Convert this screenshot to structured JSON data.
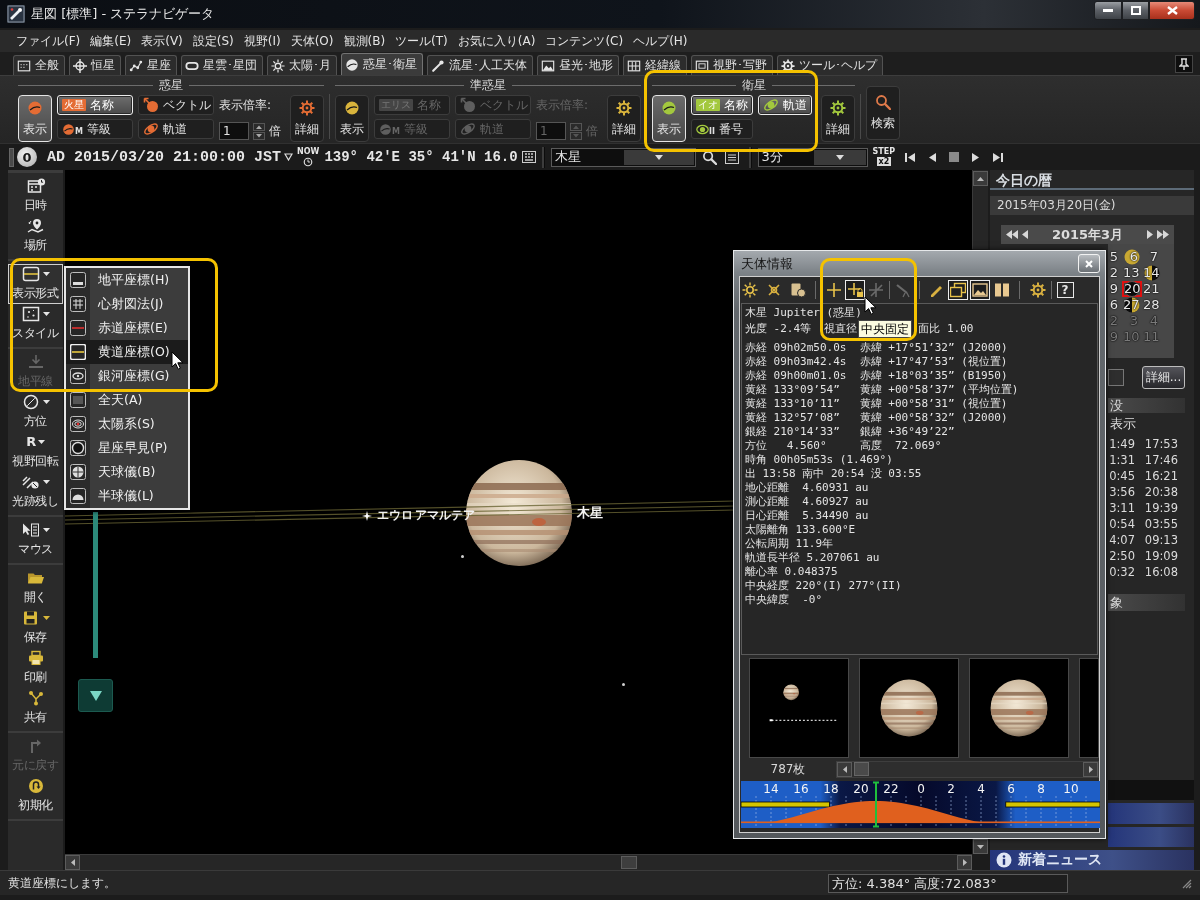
{
  "window": {
    "title": "星図 [標準] - ステラナビゲータ"
  },
  "menu": [
    "ファイル(F)",
    "編集(E)",
    "表示(V)",
    "設定(S)",
    "視野(I)",
    "天体(O)",
    "観測(B)",
    "ツール(T)",
    "お気に入り(A)",
    "コンテンツ(C)",
    "ヘルプ(H)"
  ],
  "tabs": [
    {
      "label": "全般",
      "selected": false
    },
    {
      "label": "恒星",
      "selected": false
    },
    {
      "label": "星座",
      "selected": false
    },
    {
      "label": "星雲･星団",
      "selected": false
    },
    {
      "label": "太陽･月",
      "selected": false
    },
    {
      "label": "惑星･衛星",
      "selected": true
    },
    {
      "label": "流星･人工天体",
      "selected": false
    },
    {
      "label": "昼光･地形",
      "selected": false
    },
    {
      "label": "経緯線",
      "selected": false
    },
    {
      "label": "視野･写野",
      "selected": false
    },
    {
      "label": "ツール･ヘルプ",
      "selected": false
    }
  ],
  "ribbon": {
    "groups": [
      {
        "title": "惑星",
        "highlighted": false,
        "show": {
          "label": "表示",
          "on": true
        },
        "toggles": [
          {
            "kind": "name",
            "label": "名称",
            "tag": "火星",
            "on": true,
            "disabled": false
          },
          {
            "kind": "vector",
            "label": "ベクトル",
            "on": false,
            "disabled": false
          },
          {
            "kind": "magnitude",
            "label": "等級",
            "tag": "M",
            "on": false,
            "disabled": false
          },
          {
            "kind": "orbit",
            "label": "軌道",
            "on": false,
            "disabled": false
          }
        ],
        "scale": {
          "label": "表示倍率:",
          "value": "1",
          "unit": "倍",
          "disabled": false
        },
        "detail": "詳細"
      },
      {
        "title": "準惑星",
        "highlighted": false,
        "show": {
          "label": "表示",
          "on": false
        },
        "toggles": [
          {
            "kind": "name",
            "label": "名称",
            "tag": "エリス",
            "on": false,
            "disabled": true
          },
          {
            "kind": "vector",
            "label": "ベクトル",
            "on": false,
            "disabled": true
          },
          {
            "kind": "magnitude",
            "label": "等級",
            "tag": "M",
            "on": false,
            "disabled": true
          },
          {
            "kind": "orbit",
            "label": "軌道",
            "on": false,
            "disabled": true
          }
        ],
        "scale": {
          "label": "表示倍率:",
          "value": "1",
          "unit": "倍",
          "disabled": true
        },
        "detail": "詳細"
      },
      {
        "title": "衛星",
        "highlighted": true,
        "show": {
          "label": "表示",
          "on": true
        },
        "toggles": [
          {
            "kind": "name",
            "label": "名称",
            "tag": "イオ",
            "on": true,
            "disabled": false
          },
          {
            "kind": "orbit",
            "label": "軌道",
            "on": true,
            "disabled": false
          },
          {
            "kind": "number",
            "label": "番号",
            "tag": "II",
            "on": false,
            "disabled": false
          }
        ],
        "detail": "詳細"
      }
    ],
    "search": "検索"
  },
  "time_bar": {
    "moon_age": "0",
    "datetime": "AD 2015/03/20 21:00:00 JST",
    "now_label": "NOW",
    "location": "139° 42'E 35° 41'N 16.0",
    "target": "木星",
    "step": "3分",
    "step_label": "STEP",
    "step_factor": "x2"
  },
  "sidebar": {
    "groups": [
      {
        "items": [
          {
            "kind": "datetime",
            "label": "日時",
            "menu": false,
            "open": false,
            "disabled": false
          },
          {
            "kind": "place",
            "label": "場所",
            "menu": false,
            "open": false,
            "disabled": false
          }
        ]
      },
      {
        "items": [
          {
            "kind": "view",
            "label": "表示形式",
            "menu": true,
            "open": true,
            "disabled": false
          },
          {
            "kind": "style",
            "label": "スタイル",
            "menu": true,
            "open": false,
            "disabled": false
          }
        ]
      },
      {
        "items": [
          {
            "kind": "horizon",
            "label": "地平線",
            "menu": false,
            "open": false,
            "disabled": true
          },
          {
            "kind": "direction",
            "label": "方位",
            "menu": true,
            "open": false,
            "disabled": false
          },
          {
            "kind": "rotate",
            "label": "視野回転",
            "glyph": "R",
            "menu": true,
            "open": false,
            "disabled": false
          },
          {
            "kind": "trail",
            "label": "光跡残し",
            "menu": true,
            "open": false,
            "disabled": false
          }
        ]
      },
      {
        "items": [
          {
            "kind": "mouse",
            "label": "マウス",
            "menu": true,
            "open": false,
            "disabled": false
          }
        ]
      },
      {
        "items": [
          {
            "kind": "open",
            "label": "開く",
            "menu": false,
            "open": false,
            "disabled": false
          },
          {
            "kind": "save",
            "label": "保存",
            "menu": true,
            "open": false,
            "disabled": false
          },
          {
            "kind": "print",
            "label": "印刷",
            "menu": false,
            "open": false,
            "disabled": false
          },
          {
            "kind": "share",
            "label": "共有",
            "menu": false,
            "open": false,
            "disabled": false
          }
        ]
      },
      {
        "items": [
          {
            "kind": "undo",
            "label": "元に戻す",
            "menu": false,
            "open": false,
            "disabled": true
          },
          {
            "kind": "reset",
            "label": "初期化",
            "menu": false,
            "open": false,
            "disabled": false
          }
        ]
      }
    ]
  },
  "popup_menu": {
    "highlighted": true,
    "items": [
      {
        "kind": "horizontal",
        "label": "地平座標(H)",
        "selected": false
      },
      {
        "kind": "gnomonic",
        "label": "心射図法(J)",
        "selected": false
      },
      {
        "kind": "equatorial",
        "label": "赤道座標(E)",
        "selected": false
      },
      {
        "kind": "ecliptic",
        "label": "黄道座標(O)",
        "selected": true
      },
      {
        "kind": "galactic",
        "label": "銀河座標(G)",
        "selected": false
      },
      {
        "kind": "allsky",
        "label": "全天(A)",
        "selected": false
      },
      {
        "kind": "solar",
        "label": "太陽系(S)",
        "selected": false
      },
      {
        "kind": "planisphere",
        "label": "星座早見(P)",
        "selected": false
      },
      {
        "kind": "globe",
        "label": "天球儀(B)",
        "selected": false
      },
      {
        "kind": "hemisphere",
        "label": "半球儀(L)",
        "selected": false
      }
    ]
  },
  "sky": {
    "planet_label": "木星",
    "moon_labels": [
      "エウロ",
      "アマルテア"
    ]
  },
  "info_window": {
    "title": "天体情報",
    "toolbar": [
      {
        "highlighted": false,
        "tools": [
          {
            "kind": "sun",
            "pressed": false,
            "disabled": false,
            "hovered": false
          },
          {
            "kind": "star",
            "pressed": false,
            "disabled": false,
            "hovered": false
          },
          {
            "kind": "card",
            "pressed": false,
            "disabled": false,
            "hovered": false
          }
        ]
      },
      {
        "highlighted": true,
        "tools": [
          {
            "kind": "crosshair",
            "pressed": false,
            "disabled": false,
            "hovered": false
          },
          {
            "kind": "crosshair_lock",
            "pressed": true,
            "disabled": false,
            "hovered": true
          },
          {
            "kind": "crosshair_off",
            "pressed": false,
            "disabled": true,
            "hovered": false
          }
        ]
      },
      {
        "highlighted": false,
        "tools": [
          {
            "kind": "telescope",
            "pressed": false,
            "disabled": true,
            "hovered": false
          }
        ]
      },
      {
        "highlighted": false,
        "tools": [
          {
            "kind": "pencil",
            "pressed": false,
            "disabled": false,
            "hovered": false
          },
          {
            "kind": "windows",
            "pressed": true,
            "disabled": false,
            "hovered": false
          },
          {
            "kind": "landscape",
            "pressed": true,
            "disabled": false,
            "hovered": false
          },
          {
            "kind": "panels",
            "pressed": false,
            "disabled": false,
            "hovered": false
          }
        ]
      },
      {
        "highlighted": false,
        "tools": [
          {
            "kind": "gear",
            "pressed": false,
            "disabled": false,
            "hovered": false
          }
        ]
      },
      {
        "highlighted": false,
        "tools": [
          {
            "kind": "help",
            "glyph": "?",
            "pressed": false,
            "disabled": false,
            "hovered": false
          }
        ]
      }
    ],
    "lines": [
      {
        "text": "木星 Jupiter (惑星)"
      },
      {
        "text": "光度 -2.4等  視直径",
        "tooltip": "中央固定",
        "after": "面比 1.00"
      },
      {
        "text": "赤経 09h02m50.0s  赤緯 +17°51’32” (J2000)"
      },
      {
        "text": "赤経 09h03m42.4s  赤緯 +17°47’53” (視位置)"
      },
      {
        "text": "赤経 09h00m01.0s  赤緯 +18°03’35” (B1950)"
      },
      {
        "text": "黄経 133°09’54”   黄緯 +00°58’37” (平均位置)"
      },
      {
        "text": "黄経 133°10’11”   黄緯 +00°58’31” (視位置)"
      },
      {
        "text": "黄経 132°57’08”   黄緯 +00°58’32” (J2000)"
      },
      {
        "text": "銀経 210°14’33”   銀緯 +36°49’22”"
      },
      {
        "text": "方位   4.560°     高度  72.069°"
      },
      {
        "text": "時角 00h05m53s (1.469°)"
      },
      {
        "text": "出 13:58 南中 20:54 没 03:55"
      },
      {
        "text": "地心距離  4.60931 au"
      },
      {
        "text": "測心距離  4.60927 au"
      },
      {
        "text": "日心距離  5.34490 au"
      },
      {
        "text": "太陽離角 133.600°E"
      },
      {
        "text": "公転周期 11.9年"
      },
      {
        "text": "軌道長半径 5.207061 au"
      },
      {
        "text": "離心率 0.048375"
      },
      {
        "text": "中央経度 220°(I) 277°(II)"
      },
      {
        "text": "中央緯度  -0°"
      }
    ],
    "photos": [
      {
        "kind": "distant"
      },
      {
        "kind": "close"
      },
      {
        "kind": "close"
      }
    ],
    "photo_count": "787枚",
    "hour_labels": [
      "14",
      "16",
      "18",
      "20",
      "22",
      "0",
      "2",
      "4",
      "6",
      "8",
      "10"
    ]
  },
  "calendar_panel": {
    "title": "今日の暦",
    "date": "2015年03月20日(金)",
    "month": "2015年3月",
    "weeks": [
      [
        {
          "day": "5",
          "kind": "plain",
          "selected": false,
          "other_month": false
        },
        {
          "day": "6",
          "kind": "full_moon",
          "selected": false,
          "other_month": false
        },
        {
          "day": "7",
          "kind": "plain",
          "selected": false,
          "other_month": false
        }
      ],
      [
        {
          "day": "2",
          "kind": "plain",
          "selected": false,
          "other_month": false
        },
        {
          "day": "13",
          "kind": "plain",
          "selected": false,
          "other_month": false
        },
        {
          "day": "14",
          "kind": "last_quarter",
          "selected": false,
          "other_month": false
        }
      ],
      [
        {
          "day": "9",
          "kind": "plain",
          "selected": false,
          "other_month": false
        },
        {
          "day": "20",
          "kind": "new_moon",
          "selected": true,
          "other_month": false
        },
        {
          "day": "21",
          "kind": "plain",
          "selected": false,
          "other_month": false
        }
      ],
      [
        {
          "day": "6",
          "kind": "plain",
          "selected": false,
          "other_month": false
        },
        {
          "day": "27",
          "kind": "first_quarter",
          "selected": false,
          "other_month": false
        },
        {
          "day": "28",
          "kind": "plain",
          "selected": false,
          "other_month": false
        }
      ],
      [
        {
          "day": "2",
          "kind": "plain",
          "selected": false,
          "other_month": true
        },
        {
          "day": "3",
          "kind": "plain",
          "selected": false,
          "other_month": true
        },
        {
          "day": "4",
          "kind": "plain",
          "selected": false,
          "other_month": true
        }
      ],
      [
        {
          "day": "9",
          "kind": "plain",
          "selected": false,
          "other_month": true
        },
        {
          "day": "10",
          "kind": "plain",
          "selected": false,
          "other_month": true
        },
        {
          "day": "11",
          "kind": "plain",
          "selected": false,
          "other_month": true
        }
      ]
    ],
    "detail_button": "詳細...",
    "times_header": "没",
    "times_caption": "表示",
    "times": [
      [
        "1:49",
        "17:53"
      ],
      [
        "1:31",
        "17:46"
      ],
      [
        "0:45",
        "16:21"
      ],
      [
        "3:56",
        "20:38"
      ],
      [
        "3:11",
        "19:39"
      ],
      [
        "0:54",
        "03:55"
      ],
      [
        "4:07",
        "09:13"
      ],
      [
        "2:50",
        "19:09"
      ],
      [
        "0:32",
        "16:08"
      ]
    ],
    "events_header": "象",
    "news": "新着ニュース"
  },
  "status_bar": {
    "message": "黄道座標にします。",
    "position": "方位: 4.384° 高度:72.083°"
  }
}
